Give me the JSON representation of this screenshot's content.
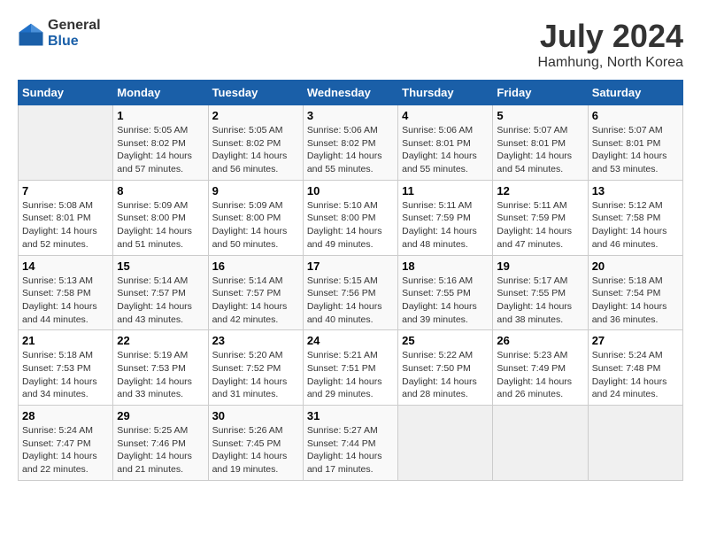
{
  "logo": {
    "general": "General",
    "blue": "Blue"
  },
  "title": "July 2024",
  "subtitle": "Hamhung, North Korea",
  "days_header": [
    "Sunday",
    "Monday",
    "Tuesday",
    "Wednesday",
    "Thursday",
    "Friday",
    "Saturday"
  ],
  "weeks": [
    [
      {
        "day": "",
        "info": ""
      },
      {
        "day": "1",
        "info": "Sunrise: 5:05 AM\nSunset: 8:02 PM\nDaylight: 14 hours\nand 57 minutes."
      },
      {
        "day": "2",
        "info": "Sunrise: 5:05 AM\nSunset: 8:02 PM\nDaylight: 14 hours\nand 56 minutes."
      },
      {
        "day": "3",
        "info": "Sunrise: 5:06 AM\nSunset: 8:02 PM\nDaylight: 14 hours\nand 55 minutes."
      },
      {
        "day": "4",
        "info": "Sunrise: 5:06 AM\nSunset: 8:01 PM\nDaylight: 14 hours\nand 55 minutes."
      },
      {
        "day": "5",
        "info": "Sunrise: 5:07 AM\nSunset: 8:01 PM\nDaylight: 14 hours\nand 54 minutes."
      },
      {
        "day": "6",
        "info": "Sunrise: 5:07 AM\nSunset: 8:01 PM\nDaylight: 14 hours\nand 53 minutes."
      }
    ],
    [
      {
        "day": "7",
        "info": "Sunrise: 5:08 AM\nSunset: 8:01 PM\nDaylight: 14 hours\nand 52 minutes."
      },
      {
        "day": "8",
        "info": "Sunrise: 5:09 AM\nSunset: 8:00 PM\nDaylight: 14 hours\nand 51 minutes."
      },
      {
        "day": "9",
        "info": "Sunrise: 5:09 AM\nSunset: 8:00 PM\nDaylight: 14 hours\nand 50 minutes."
      },
      {
        "day": "10",
        "info": "Sunrise: 5:10 AM\nSunset: 8:00 PM\nDaylight: 14 hours\nand 49 minutes."
      },
      {
        "day": "11",
        "info": "Sunrise: 5:11 AM\nSunset: 7:59 PM\nDaylight: 14 hours\nand 48 minutes."
      },
      {
        "day": "12",
        "info": "Sunrise: 5:11 AM\nSunset: 7:59 PM\nDaylight: 14 hours\nand 47 minutes."
      },
      {
        "day": "13",
        "info": "Sunrise: 5:12 AM\nSunset: 7:58 PM\nDaylight: 14 hours\nand 46 minutes."
      }
    ],
    [
      {
        "day": "14",
        "info": "Sunrise: 5:13 AM\nSunset: 7:58 PM\nDaylight: 14 hours\nand 44 minutes."
      },
      {
        "day": "15",
        "info": "Sunrise: 5:14 AM\nSunset: 7:57 PM\nDaylight: 14 hours\nand 43 minutes."
      },
      {
        "day": "16",
        "info": "Sunrise: 5:14 AM\nSunset: 7:57 PM\nDaylight: 14 hours\nand 42 minutes."
      },
      {
        "day": "17",
        "info": "Sunrise: 5:15 AM\nSunset: 7:56 PM\nDaylight: 14 hours\nand 40 minutes."
      },
      {
        "day": "18",
        "info": "Sunrise: 5:16 AM\nSunset: 7:55 PM\nDaylight: 14 hours\nand 39 minutes."
      },
      {
        "day": "19",
        "info": "Sunrise: 5:17 AM\nSunset: 7:55 PM\nDaylight: 14 hours\nand 38 minutes."
      },
      {
        "day": "20",
        "info": "Sunrise: 5:18 AM\nSunset: 7:54 PM\nDaylight: 14 hours\nand 36 minutes."
      }
    ],
    [
      {
        "day": "21",
        "info": "Sunrise: 5:18 AM\nSunset: 7:53 PM\nDaylight: 14 hours\nand 34 minutes."
      },
      {
        "day": "22",
        "info": "Sunrise: 5:19 AM\nSunset: 7:53 PM\nDaylight: 14 hours\nand 33 minutes."
      },
      {
        "day": "23",
        "info": "Sunrise: 5:20 AM\nSunset: 7:52 PM\nDaylight: 14 hours\nand 31 minutes."
      },
      {
        "day": "24",
        "info": "Sunrise: 5:21 AM\nSunset: 7:51 PM\nDaylight: 14 hours\nand 29 minutes."
      },
      {
        "day": "25",
        "info": "Sunrise: 5:22 AM\nSunset: 7:50 PM\nDaylight: 14 hours\nand 28 minutes."
      },
      {
        "day": "26",
        "info": "Sunrise: 5:23 AM\nSunset: 7:49 PM\nDaylight: 14 hours\nand 26 minutes."
      },
      {
        "day": "27",
        "info": "Sunrise: 5:24 AM\nSunset: 7:48 PM\nDaylight: 14 hours\nand 24 minutes."
      }
    ],
    [
      {
        "day": "28",
        "info": "Sunrise: 5:24 AM\nSunset: 7:47 PM\nDaylight: 14 hours\nand 22 minutes."
      },
      {
        "day": "29",
        "info": "Sunrise: 5:25 AM\nSunset: 7:46 PM\nDaylight: 14 hours\nand 21 minutes."
      },
      {
        "day": "30",
        "info": "Sunrise: 5:26 AM\nSunset: 7:45 PM\nDaylight: 14 hours\nand 19 minutes."
      },
      {
        "day": "31",
        "info": "Sunrise: 5:27 AM\nSunset: 7:44 PM\nDaylight: 14 hours\nand 17 minutes."
      },
      {
        "day": "",
        "info": ""
      },
      {
        "day": "",
        "info": ""
      },
      {
        "day": "",
        "info": ""
      }
    ]
  ]
}
